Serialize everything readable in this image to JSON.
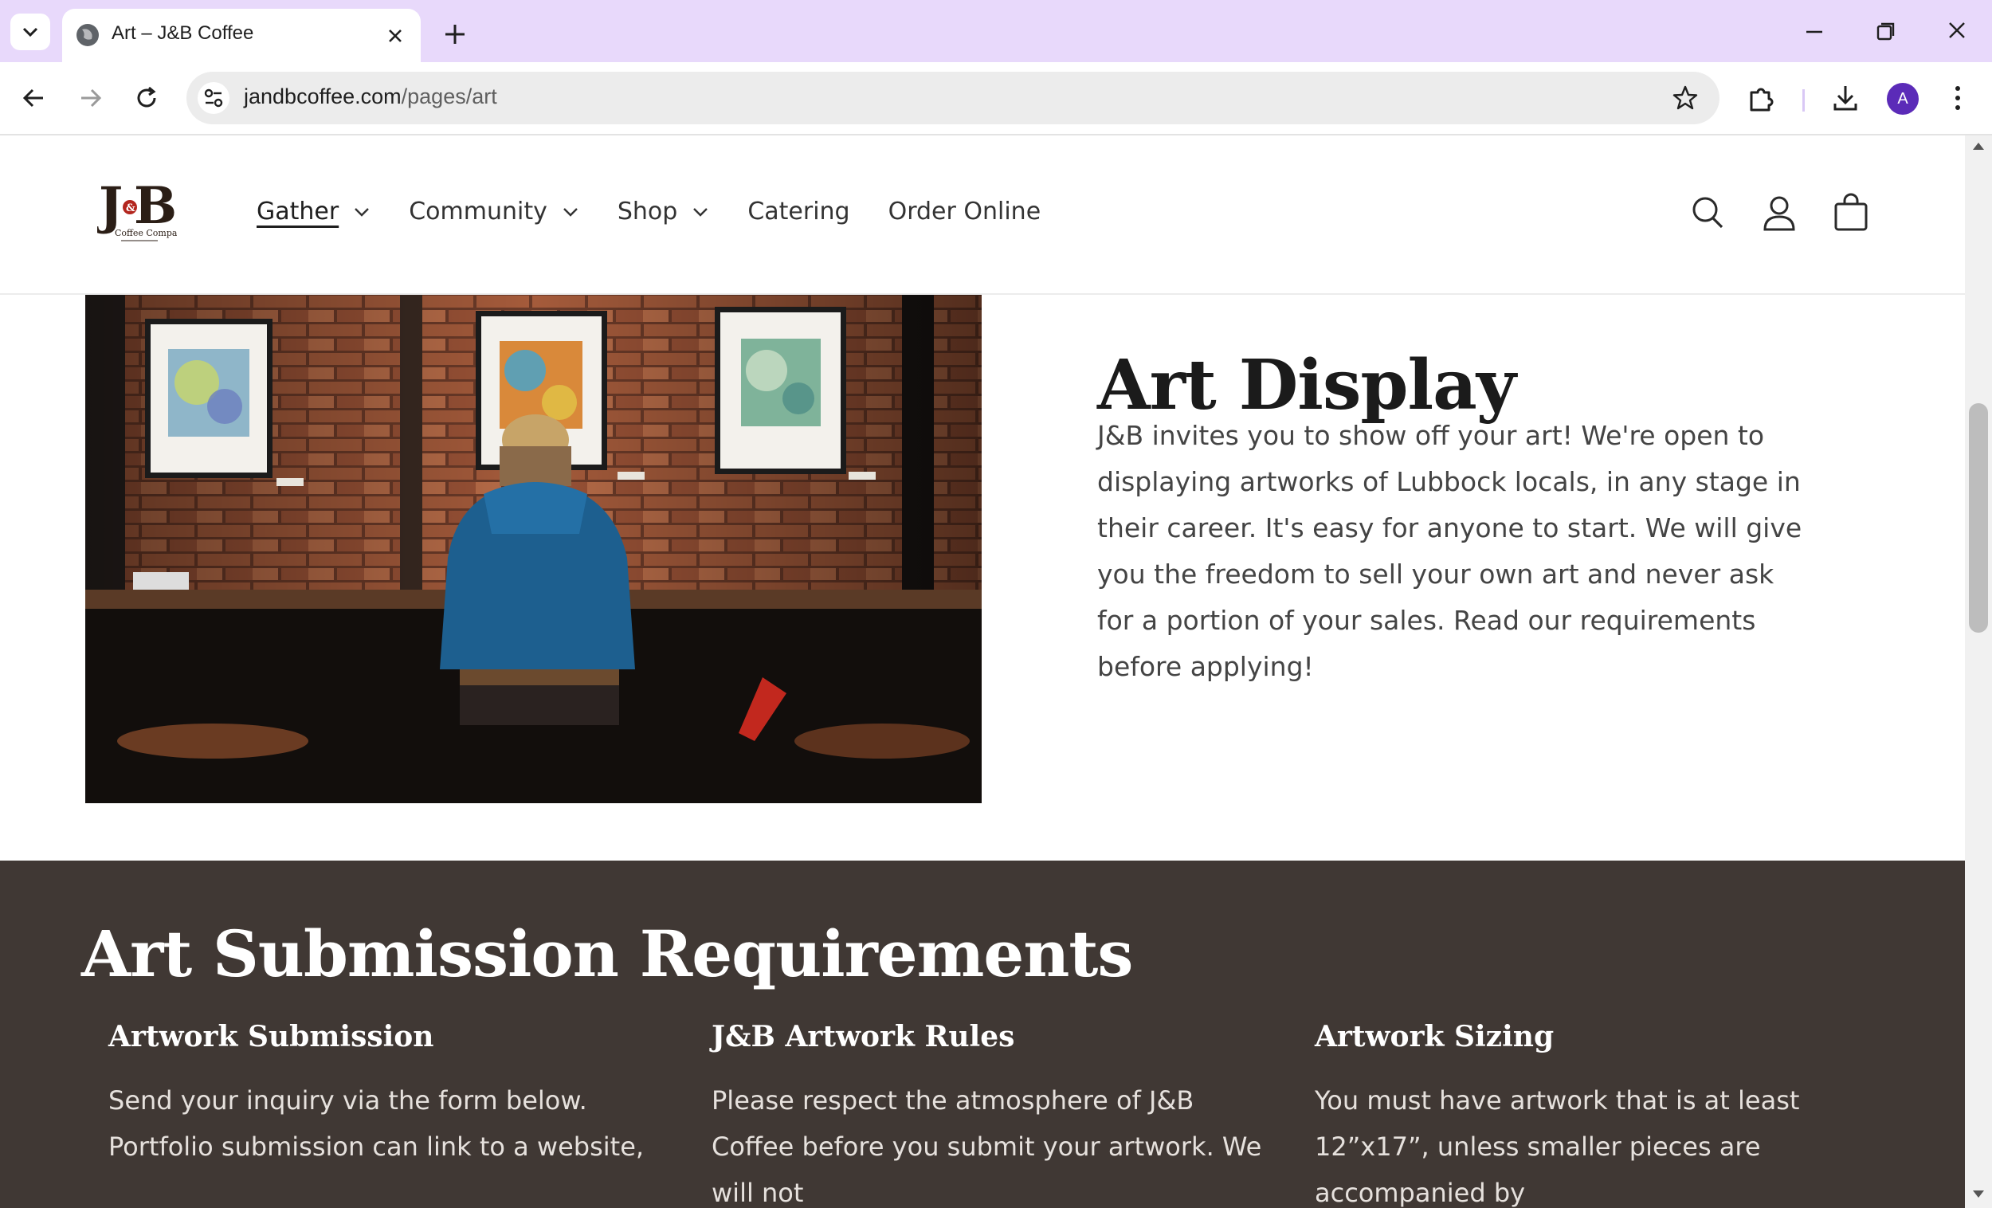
{
  "browser": {
    "tab_title": "Art – J&B Coffee",
    "url_host": "jandbcoffee.com",
    "url_path": "/pages/art",
    "profile_initial": "A"
  },
  "site": {
    "logo_text": "J&B",
    "logo_subtext": "Coffee Company",
    "nav": [
      {
        "label": "Gather",
        "has_dropdown": true,
        "active": true
      },
      {
        "label": "Community",
        "has_dropdown": true,
        "active": false
      },
      {
        "label": "Shop",
        "has_dropdown": true,
        "active": false
      },
      {
        "label": "Catering",
        "has_dropdown": false,
        "active": false
      },
      {
        "label": "Order Online",
        "has_dropdown": false,
        "active": false
      }
    ],
    "header_icons": [
      "search-icon",
      "account-icon",
      "cart-icon"
    ]
  },
  "hero": {
    "title": "Art Display",
    "body": "J&B invites you to show off your art! We're open to displaying artworks of Lubbock locals, in any stage in their career. It's easy for anyone to start. We will give you the freedom to sell your own art and never ask for a portion of your sales. Read our requirements before applying!"
  },
  "requirements": {
    "title": "Art Submission Requirements",
    "columns": [
      {
        "heading": "Artwork Submission",
        "text": "Send your inquiry via the form below. Portfolio submission can link to a website,"
      },
      {
        "heading": "J&B Artwork Rules",
        "text": "Please respect the atmosphere of J&B Coffee before you submit your artwork. We will not"
      },
      {
        "heading": "Artwork Sizing",
        "text": "You must have artwork that is at least 12”x17”, unless smaller pieces are accompanied by"
      }
    ]
  },
  "colors": {
    "tabbar": "#e8d9fb",
    "section_dark": "#403834",
    "profile": "#5b2bb8"
  }
}
